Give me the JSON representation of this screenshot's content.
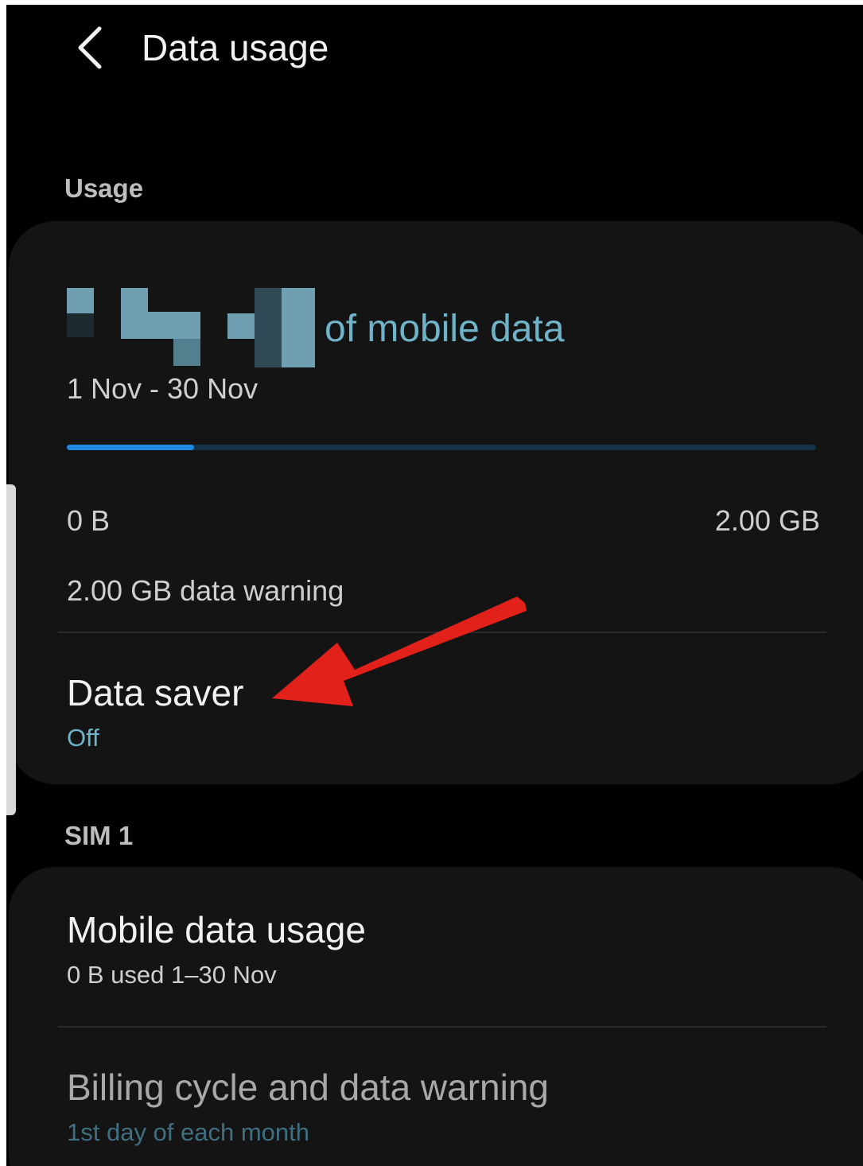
{
  "header": {
    "title": "Data usage",
    "back_icon": "chevron-left-icon"
  },
  "usage_section": {
    "header": "Usage",
    "amount_suffix": "of mobile data",
    "date_range": "1 Nov - 30 Nov",
    "progress_fraction": 0.17,
    "scale_min": "0 B",
    "scale_max": "2.00 GB",
    "warning": "2.00 GB data warning",
    "data_saver": {
      "title": "Data saver",
      "status": "Off"
    }
  },
  "sim_section": {
    "header": "SIM 1",
    "mobile_data_usage": {
      "title": "Mobile data usage",
      "subtitle": "0 B used 1–30 Nov"
    },
    "billing_cycle": {
      "title": "Billing cycle and data warning",
      "subtitle": "1st day of each month"
    }
  },
  "colors": {
    "background": "#000000",
    "card": "#141414",
    "accent": "#6fb3c8",
    "progress": "#1e88e5",
    "annotation": "#e3211b"
  }
}
